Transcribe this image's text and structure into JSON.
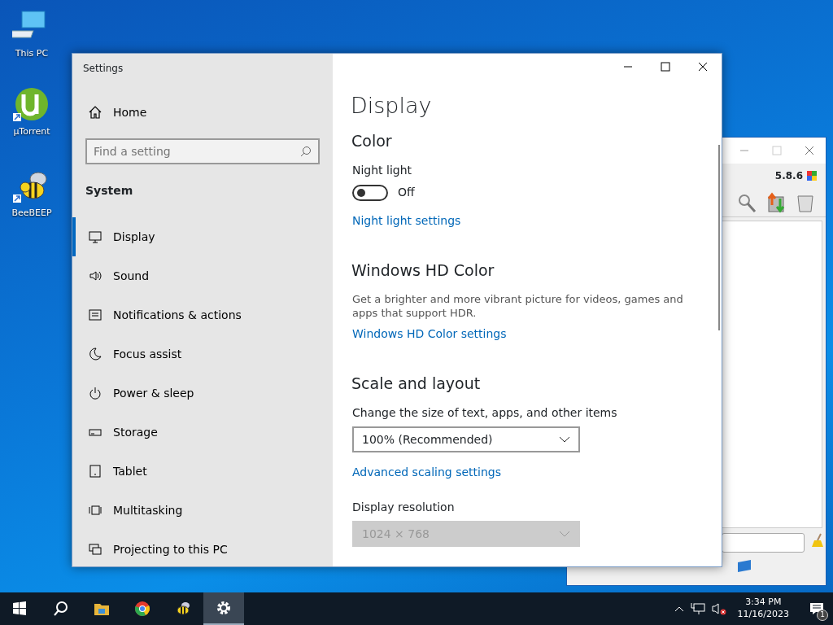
{
  "desktop_icons": [
    {
      "label": "This PC",
      "kind": "pc"
    },
    {
      "label": "µTorrent",
      "kind": "torrent"
    },
    {
      "label": "BeeBEEP",
      "kind": "bee"
    }
  ],
  "background_window": {
    "version": "5.8.6"
  },
  "settings": {
    "title": "Settings",
    "home": "Home",
    "search": {
      "placeholder": "Find a setting"
    },
    "section": "System",
    "nav": [
      {
        "label": "Display",
        "kind": "display",
        "selected": true
      },
      {
        "label": "Sound",
        "kind": "sound",
        "selected": false
      },
      {
        "label": "Notifications & actions",
        "kind": "notifications",
        "selected": false
      },
      {
        "label": "Focus assist",
        "kind": "moon",
        "selected": false
      },
      {
        "label": "Power & sleep",
        "kind": "power",
        "selected": false
      },
      {
        "label": "Storage",
        "kind": "storage",
        "selected": false
      },
      {
        "label": "Tablet",
        "kind": "tablet",
        "selected": false
      },
      {
        "label": "Multitasking",
        "kind": "multitasking",
        "selected": false
      },
      {
        "label": "Projecting to this PC",
        "kind": "projecting",
        "selected": false
      }
    ],
    "page_title": "Display",
    "blocks": [
      {
        "kind": "heading",
        "text": "Color"
      },
      {
        "kind": "label",
        "text": "Night light"
      },
      {
        "kind": "toggle",
        "on": false,
        "text": "Off"
      },
      {
        "kind": "link",
        "text": "Night light settings"
      },
      {
        "kind": "heading",
        "text": "Windows HD Color"
      },
      {
        "kind": "text",
        "text": "Get a brighter and more vibrant picture for videos, games and apps that support HDR."
      },
      {
        "kind": "link",
        "text": "Windows HD Color settings"
      },
      {
        "kind": "heading",
        "text": "Scale and layout"
      },
      {
        "kind": "label",
        "text": "Change the size of text, apps, and other items"
      },
      {
        "kind": "dropdown",
        "value": "100% (Recommended)",
        "disabled": false
      },
      {
        "kind": "link",
        "text": "Advanced scaling settings"
      },
      {
        "kind": "label",
        "text": "Display resolution"
      },
      {
        "kind": "dropdown",
        "value": "1024 × 768",
        "disabled": true
      }
    ]
  },
  "taskbar": {
    "apps": [
      {
        "kind": "start",
        "selected": false
      },
      {
        "kind": "search",
        "selected": false
      },
      {
        "kind": "folder",
        "selected": false
      },
      {
        "kind": "browser",
        "selected": false
      },
      {
        "kind": "bee",
        "selected": false
      },
      {
        "kind": "gear",
        "selected": true
      }
    ],
    "time": "3:34 PM",
    "date": "11/16/2023",
    "notifications": "1"
  }
}
